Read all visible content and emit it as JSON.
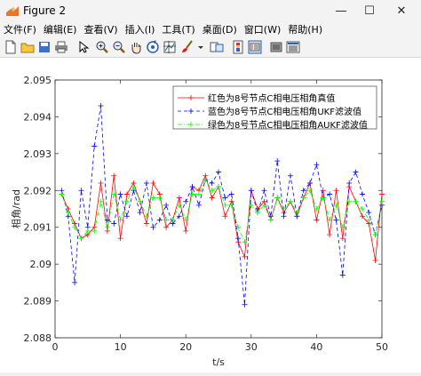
{
  "window": {
    "title": "Figure 2",
    "controls": {
      "minimize": "—",
      "maximize": "☐",
      "close": "✕"
    }
  },
  "menu": [
    "文件(F)",
    "编辑(E)",
    "查看(V)",
    "插入(I)",
    "工具(T)",
    "桌面(D)",
    "窗口(W)",
    "帮助(H)"
  ],
  "toolbar": {
    "icons": [
      "new-figure-icon",
      "open-file-icon",
      "save-icon",
      "print-icon",
      "edit-plot-icon",
      "zoom-in-icon",
      "zoom-out-icon",
      "pan-icon",
      "rotate-3d-icon",
      "data-cursor-icon",
      "brush-icon",
      "link-plot-icon",
      "colorbar-icon",
      "legend-icon",
      "hide-plot-tools-icon",
      "show-plot-tools-icon"
    ]
  },
  "colors": {
    "red": "#ff0000",
    "blue": "#0000ff",
    "green": "#00ff00"
  },
  "chart_data": {
    "type": "line",
    "xlabel": "t/s",
    "ylabel": "相角/rad",
    "xlim": [
      0,
      50
    ],
    "ylim": [
      2.088,
      2.095
    ],
    "xticks": [
      0,
      10,
      20,
      30,
      40,
      50
    ],
    "xtick_labels": [
      "0",
      "10",
      "20",
      "30",
      "40",
      "50"
    ],
    "yticks": [
      2.088,
      2.089,
      2.09,
      2.091,
      2.092,
      2.093,
      2.094,
      2.095
    ],
    "ytick_labels": [
      "2.088",
      "2.089",
      "2.09",
      "2.091",
      "2.092",
      "2.093",
      "2.094",
      "2.095"
    ],
    "grid": false,
    "legend_position": "top-right",
    "x": [
      1,
      2,
      3,
      4,
      5,
      6,
      7,
      8,
      9,
      10,
      11,
      12,
      13,
      14,
      15,
      16,
      17,
      18,
      19,
      20,
      21,
      22,
      23,
      24,
      25,
      26,
      27,
      28,
      29,
      30,
      31,
      32,
      33,
      34,
      35,
      36,
      37,
      38,
      39,
      40,
      41,
      42,
      43,
      44,
      45,
      46,
      47,
      48,
      49,
      50
    ],
    "series": [
      {
        "name": "红色为8号节点C相电压相角真值",
        "color": "#ff0000",
        "style": "solid",
        "marker": "+",
        "values": [
          2.0919,
          2.0915,
          2.0911,
          2.0907,
          2.0908,
          2.091,
          2.0922,
          2.0909,
          2.0924,
          2.0907,
          2.0919,
          2.0922,
          2.0917,
          2.0911,
          2.0922,
          2.0919,
          2.091,
          2.0912,
          2.0918,
          2.0909,
          2.0921,
          2.092,
          2.0924,
          2.0918,
          2.0921,
          2.0913,
          2.0917,
          2.0906,
          2.0902,
          2.092,
          2.0915,
          2.0917,
          2.0912,
          2.0918,
          2.0914,
          2.0917,
          2.0913,
          2.0918,
          2.0922,
          2.0912,
          2.092,
          2.0908,
          2.092,
          2.0907,
          2.0921,
          2.0917,
          2.0913,
          2.0911,
          2.0901,
          2.0919
        ]
      },
      {
        "name": "蓝色为8号节点C相电压相角UKF滤波值",
        "color": "#0000ff",
        "style": "dashed",
        "marker": "+",
        "values": [
          2.092,
          2.0913,
          2.0895,
          2.092,
          2.091,
          2.0932,
          2.0943,
          2.0912,
          2.0911,
          2.0919,
          2.0913,
          2.092,
          2.0914,
          2.0922,
          2.091,
          2.0912,
          2.0916,
          2.0911,
          2.0913,
          2.0917,
          2.0921,
          2.0916,
          2.0923,
          2.0922,
          2.0925,
          2.0918,
          2.0919,
          2.0907,
          2.0889,
          2.092,
          2.0914,
          2.092,
          2.0913,
          2.0928,
          2.0913,
          2.0924,
          2.0913,
          2.092,
          2.0922,
          2.0927,
          2.0918,
          2.0919,
          2.0912,
          2.0897,
          2.0922,
          2.0925,
          2.0919,
          2.0914,
          2.0908,
          2.0916
        ]
      },
      {
        "name": "绿色为8号节点C相电压相角AUKF滤波值",
        "color": "#00ff00",
        "style": "dashdot",
        "marker": "+",
        "values": [
          2.0919,
          2.0914,
          2.091,
          2.0907,
          2.0909,
          2.0909,
          2.0917,
          2.091,
          2.0919,
          2.0912,
          2.0917,
          2.0921,
          2.0917,
          2.0913,
          2.0918,
          2.0918,
          2.0912,
          2.0912,
          2.0916,
          2.0912,
          2.0919,
          2.0919,
          2.0923,
          2.092,
          2.0921,
          2.0916,
          2.0916,
          2.091,
          2.0906,
          2.0916,
          2.0914,
          2.0916,
          2.0912,
          2.0918,
          2.0915,
          2.0917,
          2.0914,
          2.0918,
          2.092,
          2.0915,
          2.0918,
          2.0912,
          2.0916,
          2.091,
          2.0917,
          2.0917,
          2.0915,
          2.0912,
          2.0908,
          2.0917
        ]
      }
    ]
  }
}
